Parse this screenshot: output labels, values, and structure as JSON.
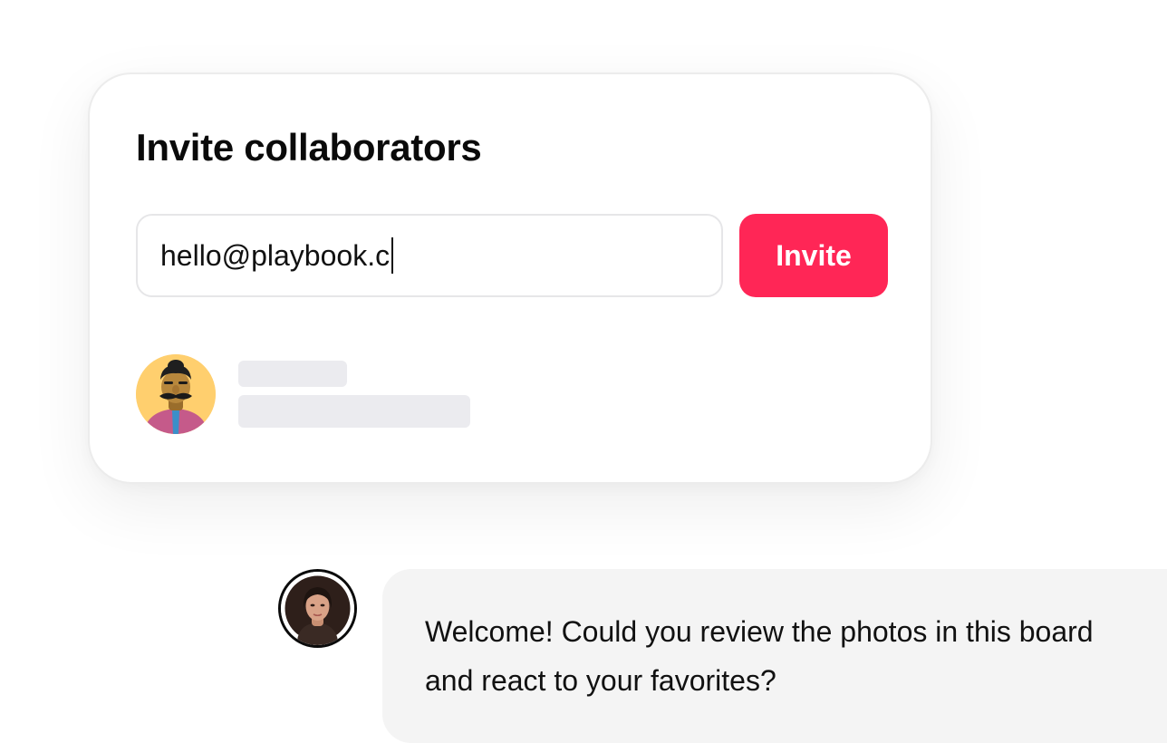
{
  "invite_card": {
    "title": "Invite collaborators",
    "email_value": "hello@playbook.c",
    "invite_label": "Invite",
    "accent_color": "#ff2656",
    "member_avatar_icon": "cartoon-man-avatar"
  },
  "chat": {
    "sender_avatar_icon": "woman-portrait-avatar",
    "message": "Welcome! Could you review the photos in this board and react to your favorites?"
  }
}
